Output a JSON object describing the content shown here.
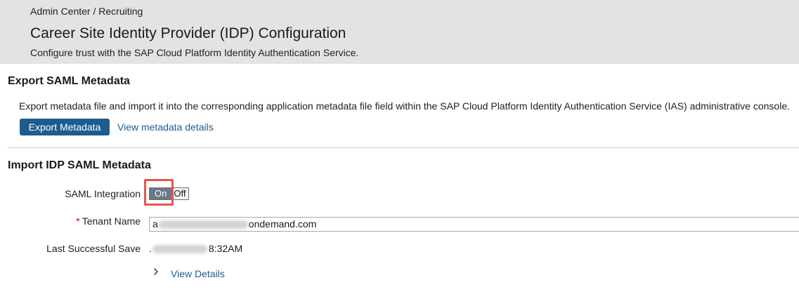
{
  "header": {
    "breadcrumb": "Admin Center / Recruiting",
    "title": "Career Site Identity Provider (IDP) Configuration",
    "subtitle": "Configure trust with the SAP Cloud Platform Identity Authentication Service."
  },
  "export_section": {
    "title": "Export SAML Metadata",
    "description": "Export metadata file and import it into the corresponding application metadata file field within the SAP Cloud Platform Identity Authentication Service (IAS) administrative console.",
    "export_button_label": "Export Metadata",
    "view_metadata_link": "View metadata details"
  },
  "import_section": {
    "title": "Import IDP SAML Metadata",
    "saml_integration": {
      "label": "SAML Integration",
      "on_label": "On",
      "off_label": "Off",
      "selected": "On"
    },
    "tenant_name": {
      "required_marker": "*",
      "label": "Tenant Name",
      "value_prefix": "a",
      "value_suffix": "ondemand.com"
    },
    "last_successful_save": {
      "label": "Last Successful Save",
      "value_prefix": ".",
      "value_suffix": "8:32AM"
    },
    "view_details_link": "View Details"
  },
  "icons": {
    "view_details_chevron": "chevron-right-icon"
  },
  "colors": {
    "header_bg": "#e3e3e3",
    "primary_button": "#1d5c8f",
    "link": "#1a5c94",
    "toggle_on": "#6a7989",
    "highlight": "#e5564a",
    "required": "#c00000"
  }
}
